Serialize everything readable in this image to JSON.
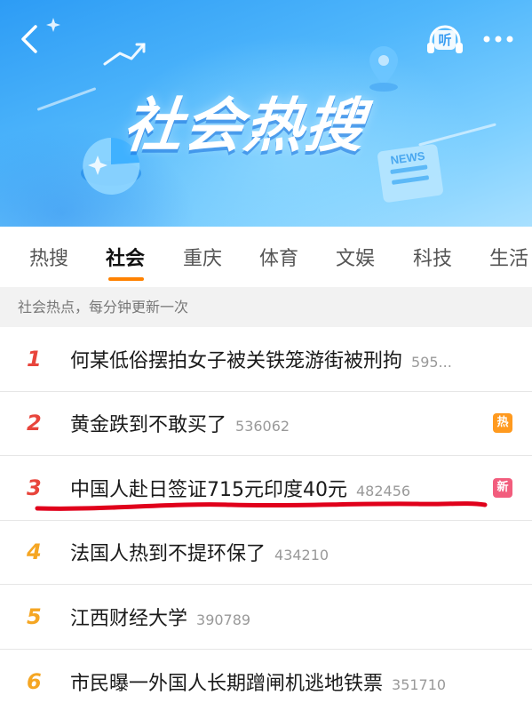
{
  "header": {
    "title": "社会热搜",
    "listen_label": "听",
    "news_label": "NEWS"
  },
  "tabs": [
    {
      "label": "热搜"
    },
    {
      "label": "社会"
    },
    {
      "label": "重庆"
    },
    {
      "label": "体育"
    },
    {
      "label": "文娱"
    },
    {
      "label": "科技"
    },
    {
      "label": "生活"
    }
  ],
  "active_tab": "社会",
  "section": {
    "caption": "社会热点，每分钟更新一次"
  },
  "items": [
    {
      "rank": "1",
      "title": "何某低俗摆拍女子被关铁笼游街被刑拘",
      "count": "595...",
      "tag": "",
      "rank_color": "#e8453c"
    },
    {
      "rank": "2",
      "title": "黄金跌到不敢买了",
      "count": "536062",
      "tag": "热",
      "rank_color": "#e8453c",
      "tag_color": "#ff9a1f"
    },
    {
      "rank": "3",
      "title": "中国人赴日签证715元印度40元",
      "count": "482456",
      "tag": "新",
      "rank_color": "#e8453c",
      "tag_color": "#f25d7d"
    },
    {
      "rank": "4",
      "title": "法国人热到不提环保了",
      "count": "434210",
      "tag": "",
      "rank_color": "#f5a623"
    },
    {
      "rank": "5",
      "title": "江西财经大学",
      "count": "390789",
      "tag": "",
      "rank_color": "#f5a623"
    },
    {
      "rank": "6",
      "title": "市民曝一外国人长期蹭闸机逃地铁票",
      "count": "351710",
      "tag": "",
      "rank_color": "#f5a623"
    }
  ],
  "colors": {
    "accent": "#ff8200",
    "banner": "#4fb6fb",
    "annotation_line": "#e0001b"
  }
}
